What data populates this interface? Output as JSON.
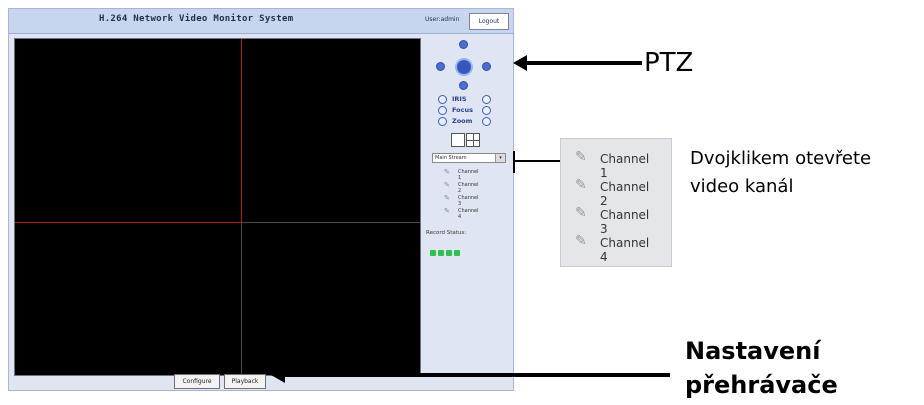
{
  "app": {
    "title": "H.264 Network Video Monitor System",
    "user_label": "User:admin",
    "logout_label": "Logout"
  },
  "ptz_controls": [
    {
      "label": "IRIS"
    },
    {
      "label": "Focus"
    },
    {
      "label": "Zoom"
    }
  ],
  "stream_select": {
    "value": "Main Stream"
  },
  "channels": [
    {
      "label": "Channel 1"
    },
    {
      "label": "Channel 2"
    },
    {
      "label": "Channel 3"
    },
    {
      "label": "Channel 4"
    }
  ],
  "record_status": {
    "label": "Record Status:"
  },
  "bottom_buttons": {
    "config_label": "Configure",
    "playback_label": "Playback"
  },
  "annotations": {
    "ptz": "PTZ",
    "channel_callout": [
      "Channel 1",
      "Channel 2",
      "Channel 3",
      "Channel 4"
    ],
    "channel_hint_line1": "Dvojklikem otevřete",
    "channel_hint_line2": "video kanál",
    "player_line1": "Nastavení",
    "player_line2": "přehrávače"
  },
  "colors": {
    "video_bg": "#000000",
    "active_pane_border": "#b31b1b",
    "panel_bg": "#dfe5f2",
    "record_indicator": "#2fc04f"
  }
}
